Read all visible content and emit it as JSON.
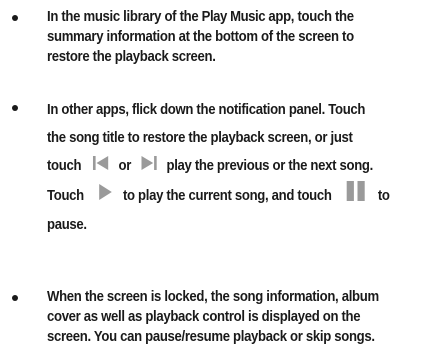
{
  "colors": {
    "text": "#1a1a1a",
    "icon": "#9a9a9a",
    "background": "#ffffff"
  },
  "bullets": {
    "first": {
      "line1_before": "In the music library of the ",
      "app_name": "Play Music",
      "line1_after": " app, touch the",
      "line2": "summary information at the bottom of the screen to",
      "line3": "restore the playback screen."
    },
    "second": {
      "line1": "In other apps, flick down the notification panel. Touch",
      "line2": "the song title to restore the playback screen, or just",
      "line3_touch": "touch",
      "line3_or": "or",
      "line3_rest": "play the previous or the next song.",
      "line4_touch": "Touch",
      "line4_mid": "to play the current song, and touch",
      "line4_to": "to",
      "line5": "pause.",
      "icons": [
        "previous-track-icon",
        "next-track-icon",
        "play-icon",
        "pause-icon"
      ]
    },
    "third": {
      "line1": "When the screen is locked, the song information, album",
      "line2": "cover as well as playback control is displayed on the",
      "line3": "screen. You can pause/resume playback or skip songs."
    }
  }
}
